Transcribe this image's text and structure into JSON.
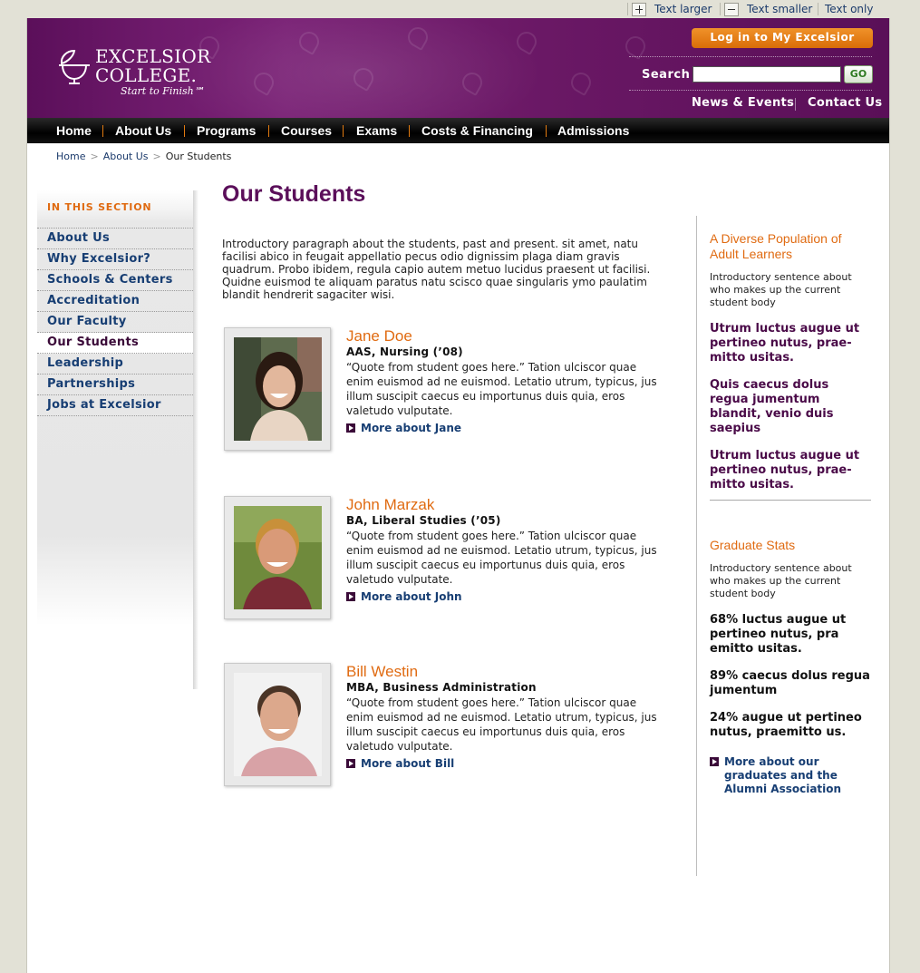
{
  "utility": {
    "text_larger": "Text larger",
    "text_smaller": "Text smaller",
    "text_only": "Text only"
  },
  "header": {
    "logo_line1": "EXCELSIOR",
    "logo_line2": "COLLEGE.",
    "logo_tagline": "Start to Finish℠",
    "login_label": "Log in to My Excelsior",
    "search_label": "Search",
    "search_value": "",
    "go_label": "GO",
    "news_events": "News & Events",
    "contact_us": "Contact Us"
  },
  "nav": [
    {
      "label": "Home"
    },
    {
      "label": "About Us"
    },
    {
      "label": "Programs"
    },
    {
      "label": "Courses"
    },
    {
      "label": "Exams"
    },
    {
      "label": "Costs & Financing"
    },
    {
      "label": "Admissions"
    }
  ],
  "breadcrumb": {
    "home": "Home",
    "about": "About Us",
    "current": "Our Students"
  },
  "sidebar": {
    "title": "IN THIS SECTION",
    "items": [
      {
        "label": "About Us"
      },
      {
        "label": "Why Excelsior?"
      },
      {
        "label": "Schools & Centers"
      },
      {
        "label": "Accreditation"
      },
      {
        "label": "Our Faculty"
      },
      {
        "label": "Our Students"
      },
      {
        "label": "Leadership"
      },
      {
        "label": "Partnerships"
      },
      {
        "label": "Jobs at Excelsior"
      }
    ]
  },
  "main": {
    "title": "Our Students",
    "intro": "Introductory paragraph about the students, past and present. sit amet, natu facilisi abico in feugait appellatio pecus odio dignissim plaga diam gravis quadrum. Probo ibidem, regula capio autem metuo lucidus praesent ut facilisi. Quidne euismod te aliquam paratus natu scisco quae singularis ymo paulatim blandit hendrerit sagaciter wisi.",
    "students": [
      {
        "name": "Jane Doe",
        "degree": "AAS, Nursing (’08)",
        "quote": "“Quote from student goes here.” Tation ulciscor quae enim euismod ad ne euismod. Letatio utrum, typicus, jus illum suscipit caecus eu importunus duis quia, eros valetudo vulputate.",
        "more": "More about Jane"
      },
      {
        "name": "John Marzak",
        "degree": "BA, Liberal Studies (’05)",
        "quote": "“Quote from student goes here.” Tation ulciscor quae enim euismod ad ne euismod. Letatio utrum, typicus, jus illum suscipit caecus eu importunus duis quia, eros valetudo vulputate.",
        "more": "More about John"
      },
      {
        "name": "Bill Westin",
        "degree": "MBA, Business Administration",
        "quote": "“Quote from student goes here.” Tation ulciscor quae enim euismod ad ne euismod. Letatio utrum, typicus, jus illum suscipit caecus eu importunus duis quia, eros valetudo vulputate.",
        "more": "More about Bill"
      }
    ]
  },
  "right": {
    "section1_title": "A Diverse Population of Adult Learners",
    "section1_intro": "Introductory sentence about who makes up the current student body",
    "section1_items": [
      "Utrum luctus augue ut pertineo nutus, prae-mitto usitas.",
      "Quis caecus dolus regua jumentum blandit, venio duis saepius",
      "Utrum luctus augue ut pertineo nutus, prae-mitto usitas."
    ],
    "section2_title": "Graduate Stats",
    "section2_intro": "Introductory sentence about who makes up the current student body",
    "section2_items": [
      "68% luctus augue ut pertineo nutus, pra emitto usitas.",
      "89% caecus dolus regua jumentum",
      "24% augue ut pertineo nutus, praemitto us."
    ],
    "more_link": "More about our graduates and the Alumni Association"
  },
  "colors": {
    "brand_purple": "#5b0f5a",
    "accent_orange": "#e06b12",
    "link_navy": "#173e73"
  }
}
